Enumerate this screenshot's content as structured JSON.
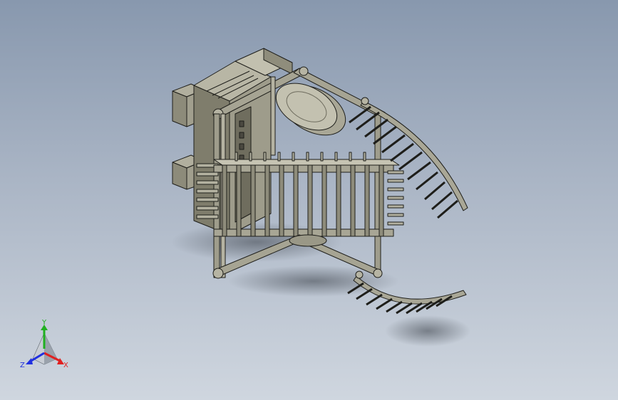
{
  "viewport": {
    "background_top": "#8898ae",
    "background_bottom": "#cfd6df"
  },
  "model": {
    "part_color": "#8c8a78",
    "edge_color": "#1e1e1a"
  },
  "triad": {
    "x_label": "X",
    "y_label": "Y",
    "z_label": "Z",
    "x_color": "#e02020",
    "y_color": "#20b020",
    "z_color": "#2030e0"
  }
}
